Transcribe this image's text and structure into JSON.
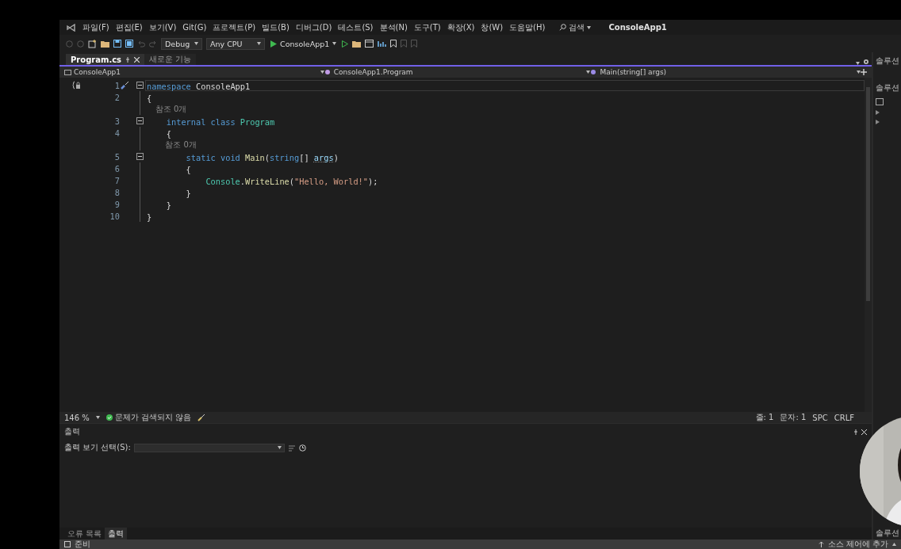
{
  "menu_bar": {
    "items": [
      "파일(F)",
      "편집(E)",
      "보기(V)",
      "Git(G)",
      "프로젝트(P)",
      "빌드(B)",
      "디버그(D)",
      "테스트(S)",
      "분석(N)",
      "도구(T)",
      "확장(X)",
      "창(W)",
      "도움말(H)"
    ],
    "search": "검색",
    "solution_title": "ConsoleApp1"
  },
  "toolbar": {
    "configuration": "Debug",
    "platform": "Any CPU",
    "run_target": "ConsoleApp1"
  },
  "document_tabs": [
    {
      "label": "Program.cs",
      "selected": true
    },
    {
      "label": "새로운 기능",
      "selected": false
    }
  ],
  "navigation_bar": {
    "project": "ConsoleApp1",
    "type": "ConsoleApp1.Program",
    "member": "Main(string[] args)"
  },
  "code_lines": [
    {
      "kind": "code",
      "number": "1",
      "fold": true,
      "current": true,
      "quick_action": true,
      "tokens": [
        {
          "kind": "keyword",
          "s": "namespace"
        },
        {
          "kind": "plain",
          "s": " ConsoleApp1"
        }
      ]
    },
    {
      "kind": "code",
      "number": "2",
      "fold": false,
      "current": false,
      "quick_action": false,
      "tokens": [
        {
          "kind": "plain",
          "s": "{"
        }
      ]
    },
    {
      "kind": "codelens",
      "text": "    참조 0개"
    },
    {
      "kind": "code",
      "number": "3",
      "fold": true,
      "current": false,
      "quick_action": false,
      "tokens": [
        {
          "kind": "keyword",
          "s": "    internal class"
        },
        {
          "kind": "type",
          "s": " Program"
        }
      ]
    },
    {
      "kind": "code",
      "number": "4",
      "fold": false,
      "current": false,
      "quick_action": false,
      "tokens": [
        {
          "kind": "plain",
          "s": "    {"
        }
      ]
    },
    {
      "kind": "codelens",
      "text": "        참조 0개"
    },
    {
      "kind": "code",
      "number": "5",
      "fold": true,
      "current": false,
      "quick_action": false,
      "tokens": [
        {
          "kind": "keyword",
          "s": "        static void"
        },
        {
          "kind": "method",
          "s": " Main"
        },
        {
          "kind": "plain",
          "s": "("
        },
        {
          "kind": "keyword",
          "s": "string"
        },
        {
          "kind": "plain",
          "s": "[] "
        },
        {
          "kind": "param",
          "s": "args"
        },
        {
          "kind": "plain",
          "s": ")"
        }
      ]
    },
    {
      "kind": "code",
      "number": "6",
      "fold": false,
      "current": false,
      "quick_action": false,
      "tokens": [
        {
          "kind": "plain",
          "s": "        {"
        }
      ]
    },
    {
      "kind": "code",
      "number": "7",
      "fold": false,
      "current": false,
      "quick_action": false,
      "tokens": [
        {
          "kind": "type",
          "s": "            Console"
        },
        {
          "kind": "plain",
          "s": "."
        },
        {
          "kind": "method",
          "s": "WriteLine"
        },
        {
          "kind": "plain",
          "s": "("
        },
        {
          "kind": "string",
          "s": "\"Hello, World!\""
        },
        {
          "kind": "plain",
          "s": ");"
        }
      ]
    },
    {
      "kind": "code",
      "number": "8",
      "fold": false,
      "current": false,
      "quick_action": false,
      "tokens": [
        {
          "kind": "plain",
          "s": "        }"
        }
      ]
    },
    {
      "kind": "code",
      "number": "9",
      "fold": false,
      "current": false,
      "quick_action": false,
      "tokens": [
        {
          "kind": "plain",
          "s": "    }"
        }
      ]
    },
    {
      "kind": "code",
      "number": "10",
      "fold": false,
      "current": false,
      "quick_action": false,
      "tokens": [
        {
          "kind": "plain",
          "s": "}"
        }
      ]
    }
  ],
  "editor_status": {
    "zoom": "146 %",
    "issues": "문제가 검색되지 않음",
    "line": "줄: 1",
    "column": "문자: 1",
    "whitespace": "SPC",
    "line_ending": "CRLF"
  },
  "output_panel": {
    "title": "출력",
    "source_label": "출력 보기 선택(S):"
  },
  "bottom_tabs": [
    {
      "label": "오류 목록",
      "selected": false
    },
    {
      "label": "출력",
      "selected": true
    }
  ],
  "solution_explorer": {
    "title": "솔루션",
    "search": "솔루션",
    "footer": "솔루션"
  },
  "status_bar": {
    "state": "준비",
    "source_control": "소스 제어에 추가"
  }
}
